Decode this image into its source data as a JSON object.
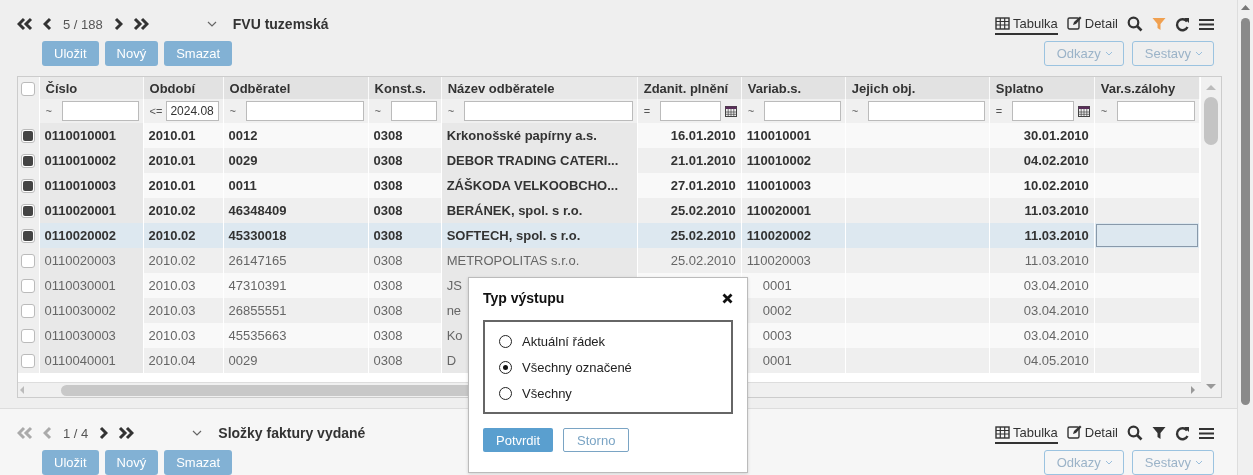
{
  "panels": [
    {
      "nav": {
        "first_disabled": false,
        "prev_disabled": false,
        "next_disabled": false,
        "last_disabled": false,
        "position": "5 / 188"
      },
      "title": "FVU tuzemská",
      "buttons": [
        "Uložit",
        "Nový",
        "Smazat"
      ],
      "views": [
        {
          "label": "Tabulka",
          "selected": true,
          "kind": "table"
        },
        {
          "label": "Detail",
          "selected": false,
          "kind": "detail"
        }
      ],
      "filter_active": true,
      "menus": [
        "Odkazy",
        "Sestavy"
      ]
    },
    {
      "nav": {
        "first_disabled": true,
        "prev_disabled": true,
        "next_disabled": false,
        "last_disabled": false,
        "position": "1 / 4"
      },
      "title": "Složky faktury vydané",
      "buttons": [
        "Uložit",
        "Nový",
        "Smazat"
      ],
      "views": [
        {
          "label": "Tabulka",
          "selected": true,
          "kind": "table"
        },
        {
          "label": "Detail",
          "selected": false,
          "kind": "detail"
        }
      ],
      "filter_active": false,
      "menus": [
        "Odkazy",
        "Sestavy"
      ]
    }
  ],
  "table": {
    "all_checked": false,
    "columns": [
      {
        "label": "Číslo",
        "shaded": true,
        "op": "~",
        "kind": "text"
      },
      {
        "label": "Období",
        "shaded": false,
        "op": "<=",
        "value": "2024.08",
        "kind": "text"
      },
      {
        "label": "Odběratel",
        "shaded": false,
        "op": "~",
        "kind": "text"
      },
      {
        "label": "Konst.s.",
        "shaded": false,
        "op": "~",
        "kind": "text"
      },
      {
        "label": "Název odběratele",
        "shaded": true,
        "op": "~",
        "kind": "text"
      },
      {
        "label": "Zdanit. plnění",
        "shaded": false,
        "op": "=",
        "kind": "date"
      },
      {
        "label": "Variab.s.",
        "shaded": false,
        "op": "~",
        "kind": "text"
      },
      {
        "label": "Jejich obj.",
        "shaded": false,
        "op": "~",
        "kind": "text"
      },
      {
        "label": "Splatno",
        "shaded": false,
        "op": "=",
        "kind": "date"
      },
      {
        "label": "Var.s.zálohy",
        "shaded": false,
        "op": "~",
        "kind": "text"
      }
    ],
    "rows": [
      {
        "checked": true,
        "selected": false,
        "cells": [
          "0110010001",
          "2010.01",
          "0012",
          "0308",
          "Krkonošské papírny a.s.",
          "16.01.2010",
          "110010001",
          null,
          "30.01.2010",
          null
        ]
      },
      {
        "checked": true,
        "selected": false,
        "cells": [
          "0110010002",
          "2010.01",
          "0029",
          "0308",
          "DEBOR TRADING CATERI...",
          "21.01.2010",
          "110010002",
          null,
          "04.02.2010",
          null
        ]
      },
      {
        "checked": true,
        "selected": false,
        "cells": [
          "0110010003",
          "2010.01",
          "0011",
          "0308",
          "ZÁŠKODA VELKOOBCHO...",
          "27.01.2010",
          "110010003",
          null,
          "10.02.2010",
          null
        ]
      },
      {
        "checked": true,
        "selected": false,
        "cells": [
          "0110020001",
          "2010.02",
          "46348409",
          "0308",
          "BERÁNEK, spol. s r.o.",
          "25.02.2010",
          "110020001",
          null,
          "11.03.2010",
          null
        ]
      },
      {
        "checked": true,
        "selected": true,
        "cells": [
          "0110020002",
          "2010.02",
          "45330018",
          "0308",
          "SOFTECH, spol. s r.o.",
          "25.02.2010",
          "110020002",
          null,
          "11.03.2010",
          {
            "focused": true
          }
        ]
      },
      {
        "checked": false,
        "selected": false,
        "cells": [
          "0110020003",
          "2010.02",
          "26147165",
          "0308",
          "METROPOLITAS s.r.o.",
          "25.02.2010",
          "110020003",
          null,
          "11.03.2010",
          null
        ]
      },
      {
        "checked": false,
        "selected": false,
        "cells": [
          "0110030001",
          "2010.03",
          "47310391",
          "0308",
          "JS",
          null,
          {
            "text": "0001",
            "kind": "clipped"
          },
          null,
          "03.04.2010",
          null
        ]
      },
      {
        "checked": false,
        "selected": false,
        "cells": [
          "0110030002",
          "2010.03",
          "26855551",
          "0308",
          "ne",
          null,
          {
            "text": "0002",
            "kind": "clipped"
          },
          null,
          "03.04.2010",
          null
        ]
      },
      {
        "checked": false,
        "selected": false,
        "cells": [
          "0110030003",
          "2010.03",
          "45535663",
          "0308",
          "Ko",
          null,
          {
            "text": "0003",
            "kind": "clipped"
          },
          null,
          "03.04.2010",
          null
        ]
      },
      {
        "checked": false,
        "selected": false,
        "cells": [
          "0110040001",
          "2010.04",
          "0029",
          "0308",
          "D",
          null,
          {
            "text": "0001",
            "kind": "clipped"
          },
          null,
          "04.05.2010",
          null
        ]
      }
    ]
  },
  "dialog": {
    "title": "Typ výstupu",
    "options": [
      {
        "label": "Aktuální řádek",
        "selected": false
      },
      {
        "label": "Všechny označené",
        "selected": true
      },
      {
        "label": "Všechny",
        "selected": false
      }
    ],
    "buttons": [
      {
        "label": "Potvrdit",
        "kind": "primary"
      },
      {
        "label": "Storno",
        "kind": "secondary"
      }
    ]
  }
}
